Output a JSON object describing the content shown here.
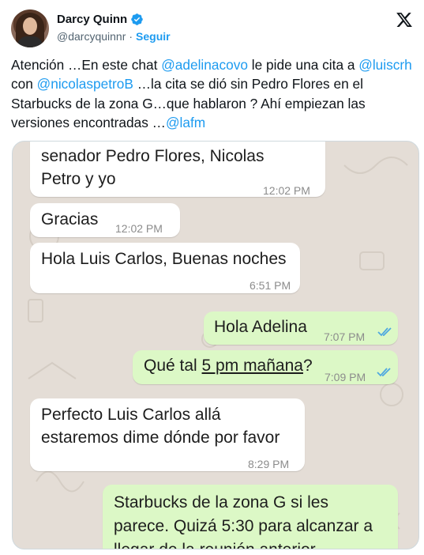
{
  "author": {
    "name": "Darcy Quinn",
    "handle": "@darcyquinnr",
    "separator": "·",
    "follow_label": "Seguir",
    "verified_icon": "verified-badge-icon",
    "verified_color": "#1d9bf0"
  },
  "platform_icon": "x-logo-icon",
  "tweet": {
    "p1": "Atención …En este chat ",
    "m1": "@adelinacovo",
    "p2": " le pide una cita a ",
    "m2": "@luiscrh",
    "p3": " con ",
    "m3": "@nicolaspetroB",
    "p4": " …la cita se dió sin Pedro Flores en el Starbucks de la zona G…que hablaron ? Ahí empiezan las versiones encontradas …",
    "m4": "@lafm"
  },
  "chat": {
    "m1_l1": "senador Pedro Flores, Nicolas",
    "m1_l2": "Petro y yo",
    "m1_time": "12:02 PM",
    "m2_text": "Gracias",
    "m2_time": "12:02 PM",
    "m3_text": "Hola Luis Carlos, Buenas noches",
    "m3_time": "6:51 PM",
    "m4_text": "Hola Adelina",
    "m4_time": "7:07 PM",
    "m5_pre": "Qué tal ",
    "m5_link": "5 pm mañana",
    "m5_post": "?",
    "m5_time": "7:09 PM",
    "m6_l1": "Perfecto Luis Carlos allá",
    "m6_l2": "estaremos dime dónde por favor",
    "m6_time": "8:29 PM",
    "m7_l1": "Starbucks de la zona G si les",
    "m7_l2": "parece. Quizá 5:30 para alcanzar a",
    "m7_l3": "llegar de la reunión anterior",
    "incoming_color": "#ffffff",
    "outgoing_color": "#dcf8c6",
    "read_ticks_color": "#4fc3f7"
  }
}
